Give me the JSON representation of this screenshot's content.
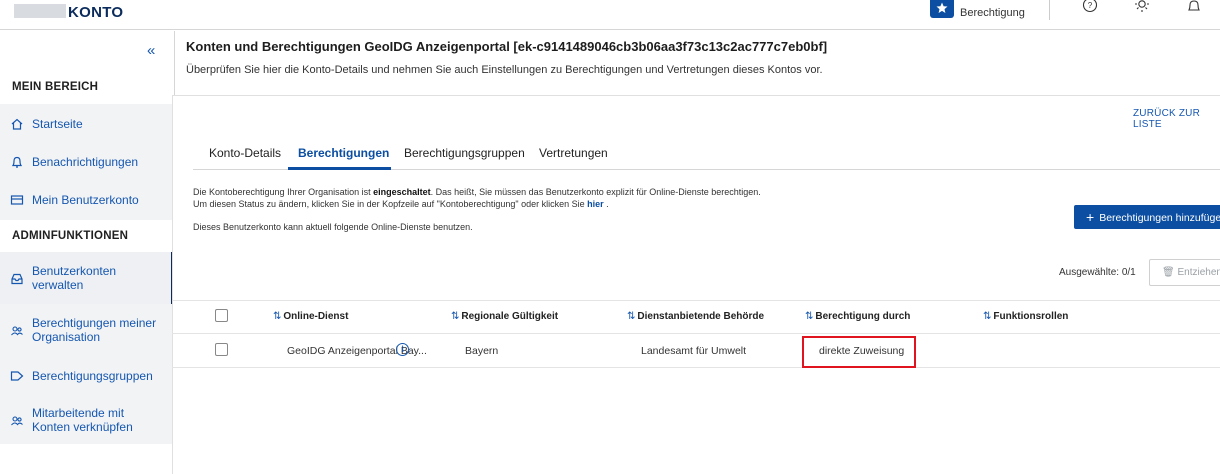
{
  "header": {
    "app_title": "KONTO",
    "permission_label": "Berechtigung",
    "icons": [
      "help-icon",
      "gear-icon",
      "bell-icon"
    ]
  },
  "sidebar": {
    "collapse_glyph": "«",
    "sections": [
      {
        "title": "MEIN BEREICH"
      },
      {
        "title": "ADMINFUNKTIONEN"
      }
    ],
    "items": [
      {
        "label": "Startseite",
        "icon": "home-icon"
      },
      {
        "label": "Benachrichtigungen",
        "icon": "bell-icon"
      },
      {
        "label": "Mein Benutzerkonto",
        "icon": "id-card-icon"
      },
      {
        "label": "Benutzerkonten verwalten",
        "icon": "inbox-icon",
        "active": true
      },
      {
        "label": "Berechtigungen meiner Organisation",
        "icon": "users-icon"
      },
      {
        "label": "Berechtigungsgruppen",
        "icon": "tag-icon"
      },
      {
        "label": "Mitarbeitende mit Konten verknüpfen",
        "icon": "users-link-icon"
      }
    ]
  },
  "main": {
    "title": "Konten und Berechtigungen GeoIDG Anzeigenportal [ek-c9141489046cb3b06aa3f73c13c2ac777c7eb0bf]",
    "subtitle": "Überprüfen Sie hier die Konto-Details und nehmen Sie auch Einstellungen zu Berechtigungen und Vertretungen dieses Kontos vor.",
    "back_link": "ZURÜCK ZUR LISTE",
    "tabs": [
      {
        "label": "Konto-Details"
      },
      {
        "label": "Berechtigungen",
        "active": true
      },
      {
        "label": "Berechtigungsgruppen"
      },
      {
        "label": "Vertretungen"
      }
    ],
    "info": {
      "line1_a": "Die Kontoberechtigung Ihrer Organisation ist ",
      "line1_b": "eingeschaltet",
      "line1_c": ". Das heißt, Sie müssen das Benutzerkonto explizit für Online-Dienste berechtigen.",
      "line2_a": "Um diesen Status zu ändern, klicken Sie in der Kopfzeile auf \"Kontoberechtigung\" oder klicken Sie ",
      "line2_link": "hier",
      "line2_c": " .",
      "line3": "Dieses Benutzerkonto kann aktuell folgende Online-Dienste benutzen."
    },
    "add_button": "Berechtigungen hinzufügen",
    "selected_count": "Ausgewählte: 0/1",
    "remove_button": "Entziehen"
  },
  "table": {
    "sort_glyph": "⇅",
    "columns": [
      "Online-Dienst",
      "Regionale Gültigkeit",
      "Dienstanbietende Behörde",
      "Berechtigung durch",
      "Funktionsrollen"
    ],
    "rows": [
      {
        "online_dienst": "GeoIDG Anzeigenportal Bay...",
        "region": "Bayern",
        "behoerde": "Landesamt für Umwelt",
        "berechtigung": "direkte Zuweisung",
        "rollen": ""
      }
    ]
  },
  "colors": {
    "accent": "#0b4ea2",
    "link": "#1557b0",
    "highlight": "#e0141e"
  }
}
